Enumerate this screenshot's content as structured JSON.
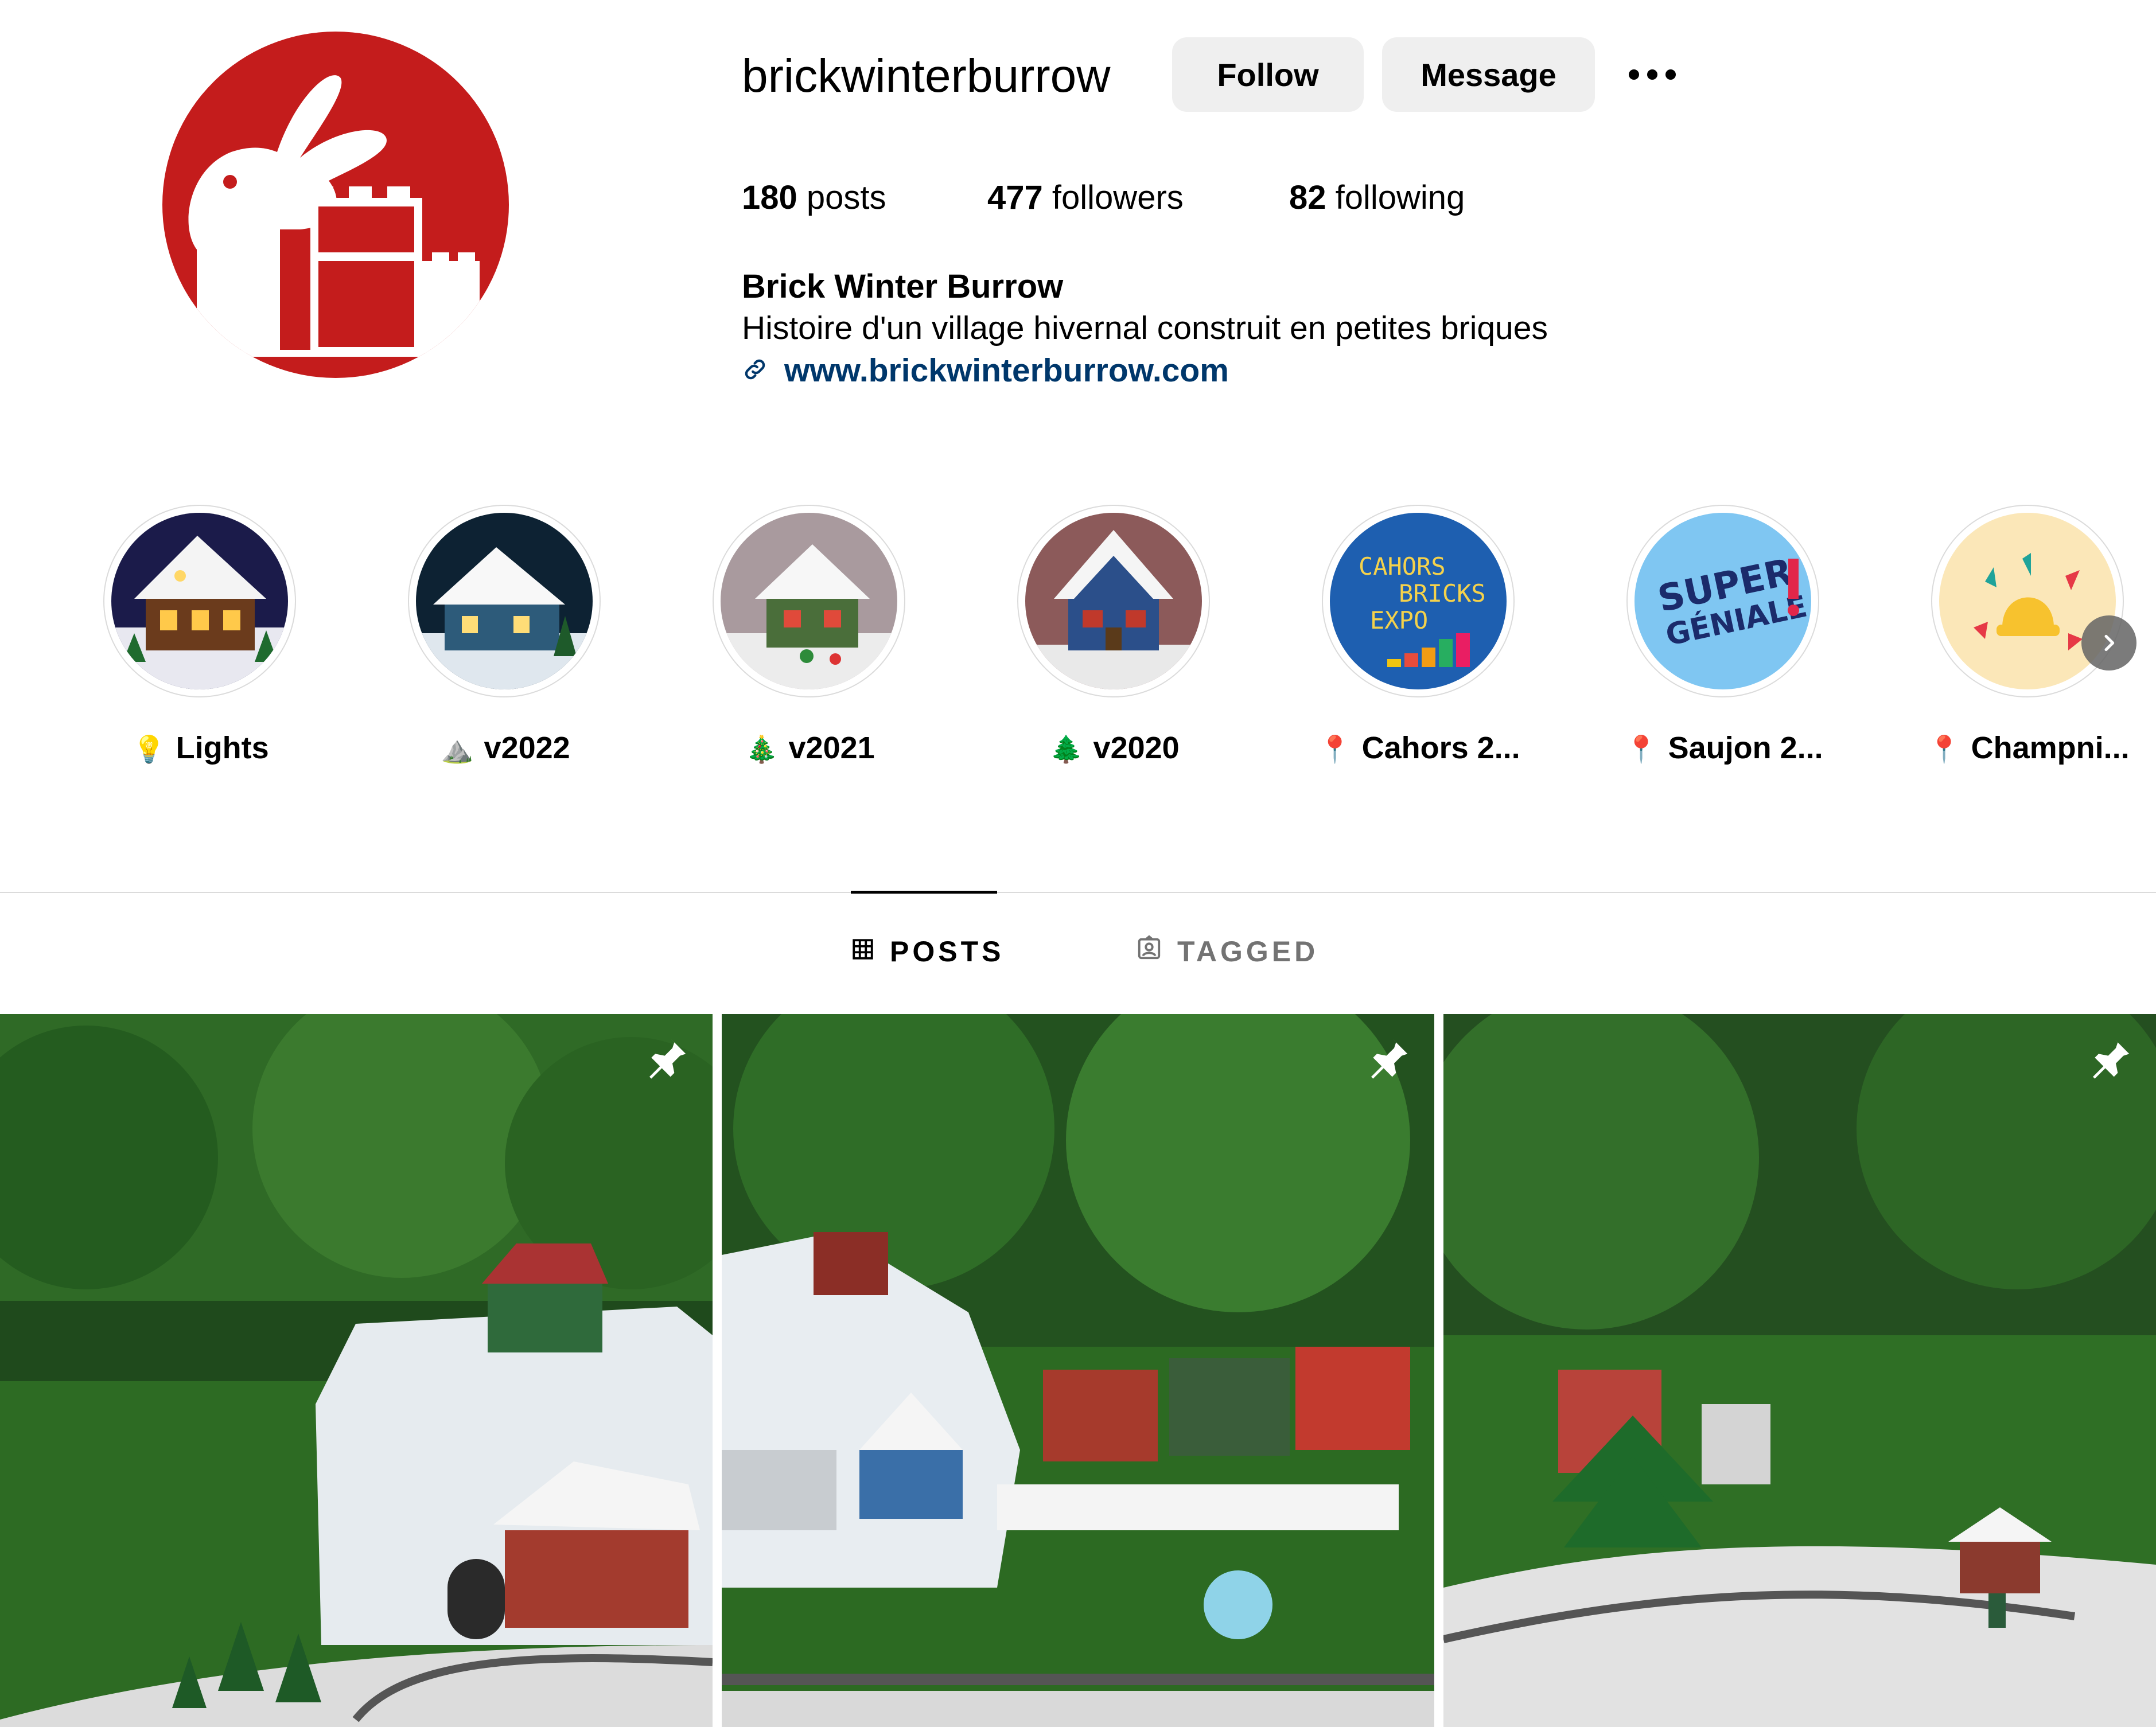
{
  "profile": {
    "username": "brickwinterburrow",
    "follow_label": "Follow",
    "message_label": "Message",
    "more_icon": "more-horizontal-icon",
    "stats": {
      "posts_count": "180",
      "posts_label": "posts",
      "followers_count": "477",
      "followers_label": "followers",
      "following_count": "82",
      "following_label": "following"
    },
    "display_name": "Brick Winter Burrow",
    "bio": "Histoire d'un village hivernal construit en petites briques",
    "link": "www.brickwinterburrow.com",
    "avatar_color": "#c41c1c"
  },
  "highlights": [
    {
      "emoji": "💡",
      "label": "Lights"
    },
    {
      "emoji": "⛰️",
      "label": "v2022"
    },
    {
      "emoji": "🎄",
      "label": "v2021"
    },
    {
      "emoji": "🌲",
      "label": "v2020"
    },
    {
      "emoji": "📍",
      "label": "Cahors 2..."
    },
    {
      "emoji": "📍",
      "label": "Saujon 2..."
    },
    {
      "emoji": "📍",
      "label": "Champni..."
    }
  ],
  "highlight_art": {
    "cahors_text": [
      "CAHORS",
      "BRICKS",
      "EXPO"
    ],
    "saujon_text": [
      "SUPER",
      "GÉNIALE"
    ]
  },
  "tabs": [
    {
      "label": "POSTS",
      "icon": "grid-icon",
      "active": true
    },
    {
      "label": "TAGGED",
      "icon": "tagged-icon",
      "active": false
    }
  ],
  "posts": [
    {
      "pinned": true,
      "icon": "pin-icon"
    },
    {
      "pinned": true,
      "icon": "pin-icon"
    },
    {
      "pinned": true,
      "icon": "pin-icon"
    }
  ],
  "colors": {
    "link": "#00376b",
    "button_bg": "#efefef",
    "divider": "#dbdbdb",
    "inactive_tab": "#737373"
  }
}
